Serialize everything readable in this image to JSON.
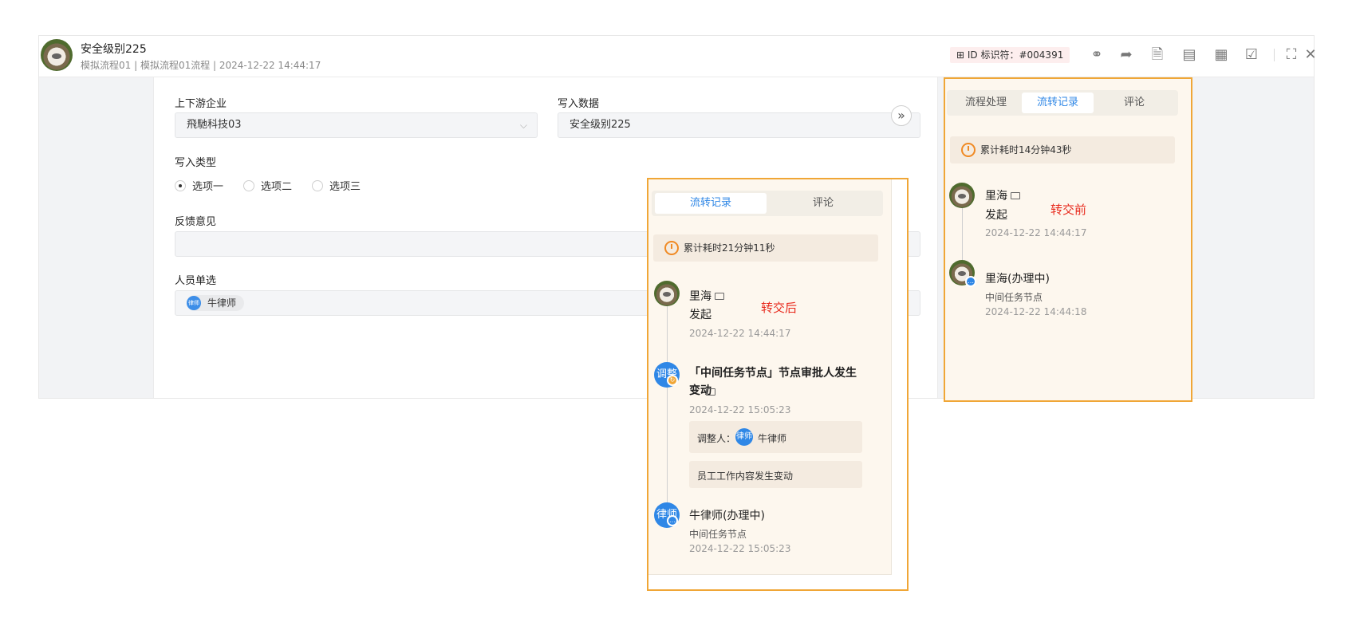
{
  "header": {
    "title": "安全级别225",
    "subtitle": "模拟流程01 | 模拟流程01流程 | 2024-12-22 14:44:17",
    "id_tag": "ID 标识符：#004391"
  },
  "form": {
    "field1_label": "上下游企业",
    "field1_value": "飛馳科技03",
    "field2_label": "写入数据",
    "field2_value": "安全级别225",
    "field3_label": "写入类型",
    "radio_options": [
      "选项一",
      "选项二",
      "选项三"
    ],
    "radio_selected": "选项一",
    "field4_label": "反馈意见",
    "field4_value": "",
    "field5_label": "人员单选",
    "person_avatar_text": "律师",
    "person_name": "牛律师"
  },
  "right_panel": {
    "tabs": [
      "流程处理",
      "流转记录",
      "评论"
    ],
    "active_tab": "流转记录",
    "elapsed": "累计耗时14分钟43秒",
    "note": "转交前",
    "records": [
      {
        "name": "里海",
        "action": "发起",
        "time": "2024-12-22 14:44:17"
      },
      {
        "name": "里海(办理中)",
        "node": "中间任务节点",
        "time": "2024-12-22 14:44:18"
      }
    ]
  },
  "mid_panel": {
    "tabs": [
      "流转记录",
      "评论"
    ],
    "active_tab": "流转记录",
    "elapsed": "累计耗时21分钟11秒",
    "note": "转交后",
    "records": [
      {
        "name": "里海",
        "action": "发起",
        "time": "2024-12-22 14:44:17"
      },
      {
        "avatar_text": "调整",
        "title": "「中间任务节点」节点审批人发生变动",
        "time": "2024-12-22 15:05:23",
        "adjuster_label": "调整人：",
        "adjuster_avatar": "律师",
        "adjuster_name": "牛律师",
        "reason": "员工工作内容发生变动"
      },
      {
        "avatar_text": "律师",
        "name": "牛律师(办理中)",
        "node": "中间任务节点",
        "time": "2024-12-22 15:05:23"
      }
    ]
  },
  "colors": {
    "accent": "#2f87e6",
    "highlight": "#f0a636",
    "note": "#e8291c"
  }
}
